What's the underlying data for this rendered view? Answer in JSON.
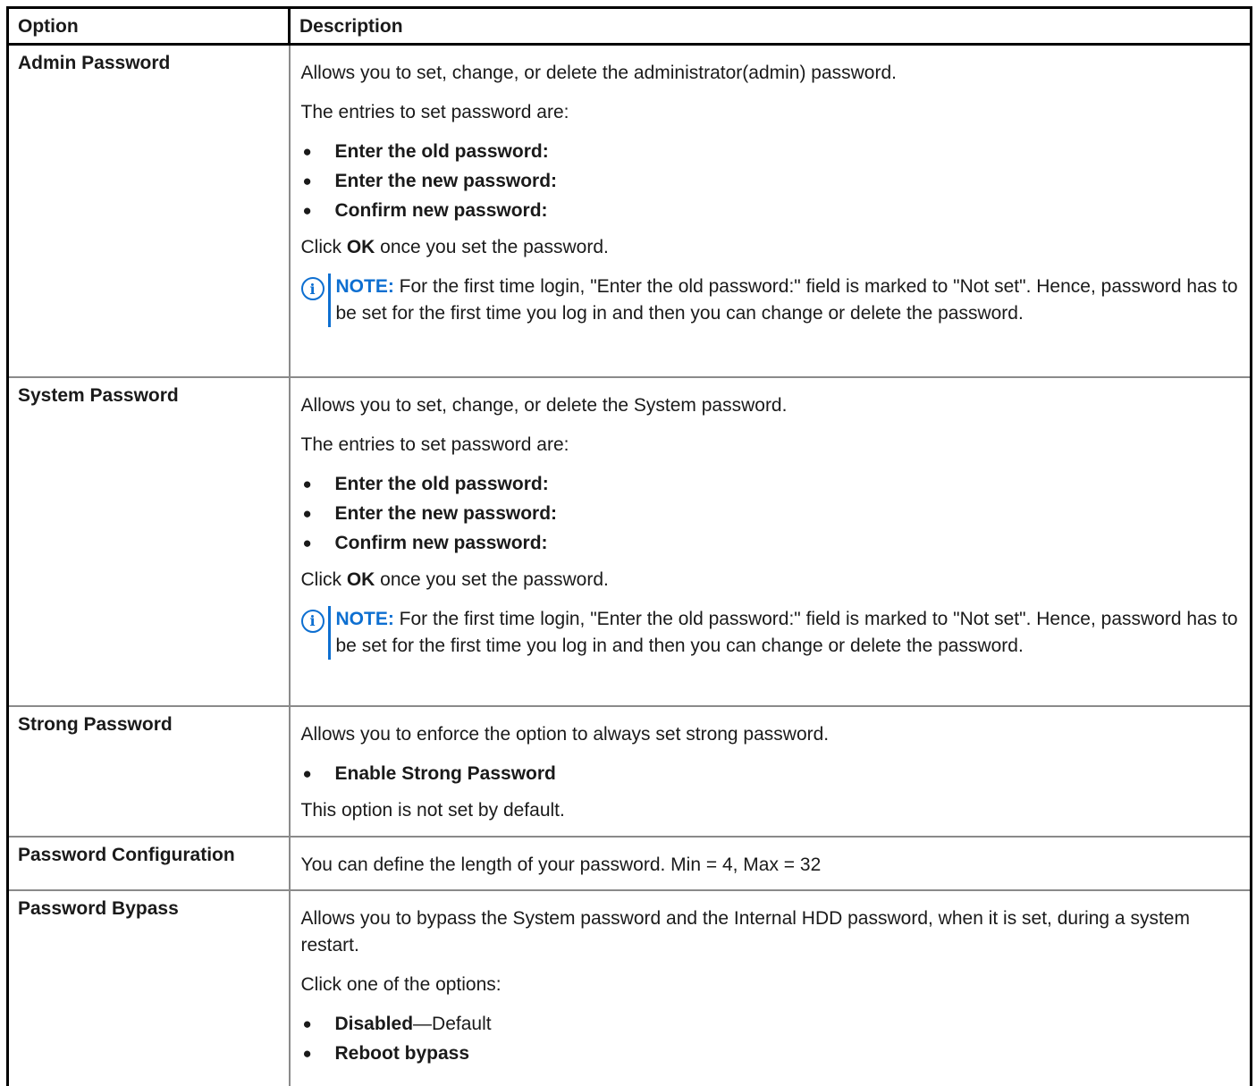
{
  "table": {
    "header": {
      "option": "Option",
      "description": "Description"
    },
    "bullet": "●",
    "note_icon": "info-icon",
    "rows": {
      "admin": {
        "option": "Admin Password",
        "intro": "Allows you to set, change, or delete the administrator(admin) password.",
        "entries": "The entries to set password are:",
        "bullets": [
          "Enter the old password:",
          "Enter the new password:",
          "Confirm new password:"
        ],
        "click_pre": "Click ",
        "click_bold": "OK",
        "click_post": " once you set the password.",
        "note_label": "NOTE:",
        "note_text": " For the first time login, \"Enter the old password:\" field is marked to \"Not set\". Hence, password has to be set for the first time you log in and then you can change or delete the password."
      },
      "system": {
        "option": "System Password",
        "intro": "Allows you to set, change, or delete the System password.",
        "entries": "The entries to set password are:",
        "bullets": [
          "Enter the old password:",
          "Enter the new password:",
          "Confirm new password:"
        ],
        "click_pre": "Click ",
        "click_bold": "OK",
        "click_post": " once you set the password.",
        "note_label": "NOTE:",
        "note_text": " For the first time login, \"Enter the old password:\" field is marked to \"Not set\". Hence, password has to be set for the first time you log in and then you can change or delete the password."
      },
      "strong": {
        "option": "Strong Password",
        "intro": "Allows you to enforce the option to always set strong password.",
        "bullets": [
          "Enable Strong Password"
        ],
        "footer": "This option is not set by default."
      },
      "config": {
        "option": "Password Configuration",
        "intro": "You can define the length of your password. Min = 4, Max = 32"
      },
      "bypass": {
        "option": "Password Bypass",
        "intro": "Allows you to bypass the System password and the Internal HDD password, when it is set, during a system restart.",
        "click_options": "Click one of the options:",
        "bullets": [
          {
            "bold": "Disabled",
            "rest": "—Default"
          },
          {
            "bold": "Reboot bypass",
            "rest": ""
          }
        ]
      }
    }
  }
}
